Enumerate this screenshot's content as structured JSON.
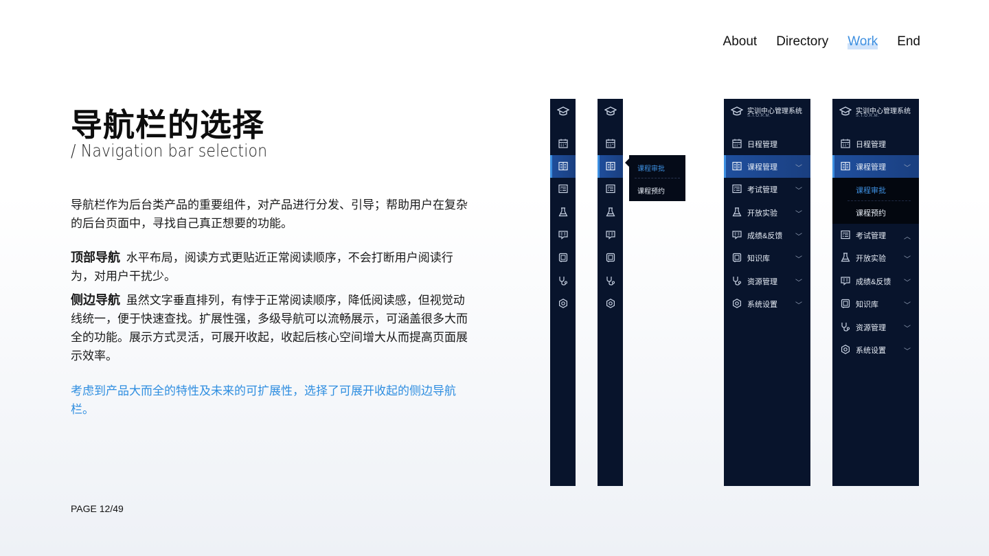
{
  "topnav": {
    "items": [
      {
        "label": "About",
        "active": false
      },
      {
        "label": "Directory",
        "active": false
      },
      {
        "label": "Work",
        "active": true
      },
      {
        "label": "End",
        "active": false
      }
    ]
  },
  "hero": {
    "title": "导航栏的选择",
    "subtitle": "/  Navigation bar selection"
  },
  "content": {
    "intro": "导航栏作为后台类产品的重要组件，对产品进行分发、引导；帮助用户在复杂的后台页面中，寻找自己真正想要的功能。",
    "top_nav_title": "顶部导航",
    "top_nav_text": "水平布局，阅读方式更贴近正常阅读顺序，不会打断用户阅读行为，对用户干扰少。",
    "side_nav_title": "侧边导航",
    "side_nav_text": "虽然文字垂直排列，有悖于正常阅读顺序，降低阅读感，但视觉动线统一，便于快速查找。扩展性强，多级导航可以流畅展示，可涵盖很多大而全的功能。展示方式灵活，可展开收起，收起后核心空间增大从而提高页面展示效率。",
    "conclusion": "考虑到产品大而全的特性及未来的可扩展性，选择了可展开收起的侧边导航栏。"
  },
  "footer": {
    "page": "PAGE 12/49"
  },
  "sidebar": {
    "brand_title": "实训中心管理系统",
    "brand_sub": "S.T.O.R.M.",
    "items": [
      {
        "label": "日程管理",
        "icon": "calendar-icon"
      },
      {
        "label": "课程管理",
        "icon": "book-icon"
      },
      {
        "label": "考试管理",
        "icon": "exam-icon"
      },
      {
        "label": "开放实验",
        "icon": "flask-icon"
      },
      {
        "label": "成绩&反馈",
        "icon": "feedback-icon"
      },
      {
        "label": "知识库",
        "icon": "knowledge-icon"
      },
      {
        "label": "资源管理",
        "icon": "stethoscope-icon"
      },
      {
        "label": "系统设置",
        "icon": "gear-icon"
      }
    ],
    "submenu": [
      {
        "label": "课程审批",
        "active": true
      },
      {
        "label": "课程预约",
        "active": false
      }
    ],
    "colors": {
      "background": "#08142c",
      "selected": "#1f4f9e",
      "accent": "#3d8fe0"
    }
  }
}
